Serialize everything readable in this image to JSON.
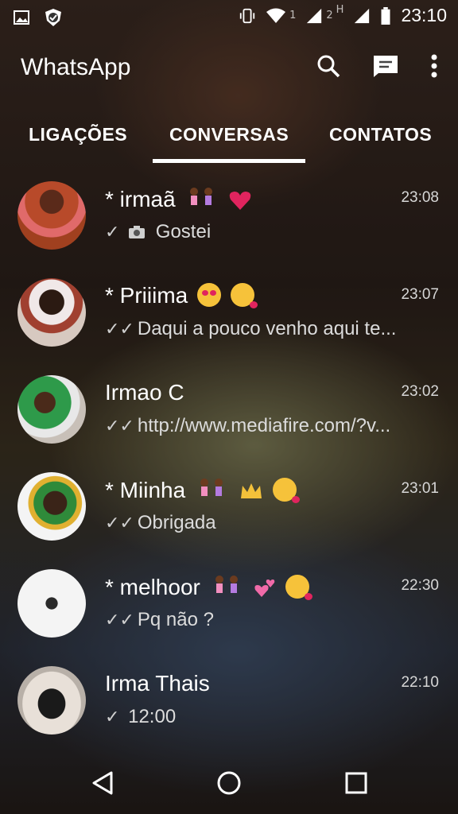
{
  "status_bar": {
    "time": "23:10",
    "sim1": "1",
    "sim2": "2",
    "network_h": "H",
    "icons": [
      "image-icon",
      "shield-icon",
      "vibrate-icon",
      "wifi-icon",
      "signal-icon",
      "battery-icon"
    ]
  },
  "app": {
    "title": "WhatsApp",
    "actions": [
      "search-icon",
      "new-chat-icon",
      "more-vert-icon"
    ]
  },
  "tabs": [
    {
      "label": "LIGAÇÕES",
      "active": false
    },
    {
      "label": "CONVERSAS",
      "active": true
    },
    {
      "label": "CONTATOS",
      "active": false
    }
  ],
  "chats": [
    {
      "name": "* irmaã",
      "emojis": [
        "two-girls",
        "red-heart"
      ],
      "time": "23:08",
      "status": "sent",
      "preview_icon": "camera-icon",
      "preview": "Gostei"
    },
    {
      "name": "* Priiima",
      "emojis": [
        "heart-eyes",
        "kissing-face"
      ],
      "time": "23:07",
      "status": "delivered",
      "preview": "Daqui a pouco venho aqui te..."
    },
    {
      "name": "Irmao C",
      "emojis": [],
      "time": "23:02",
      "status": "delivered",
      "preview": "http://www.mediafire.com/?v..."
    },
    {
      "name": "* Miinha",
      "emojis": [
        "two-girls",
        "crown",
        "kissing-face"
      ],
      "time": "23:01",
      "status": "delivered",
      "preview": "Obrigada"
    },
    {
      "name": "* melhoor",
      "emojis": [
        "two-girls",
        "two-hearts",
        "kissing-face"
      ],
      "time": "22:30",
      "status": "delivered",
      "preview": "Pq não ?"
    },
    {
      "name": "Irma Thais",
      "emojis": [],
      "time": "22:10",
      "status": "sent",
      "preview": "12:00"
    }
  ],
  "colors": {
    "accent": "#ffffff",
    "time_text": "#d7d7d7",
    "preview_text": "#dcdcdc",
    "heart": "#e0245e"
  },
  "nav": [
    "back-icon",
    "home-icon",
    "recents-icon"
  ]
}
